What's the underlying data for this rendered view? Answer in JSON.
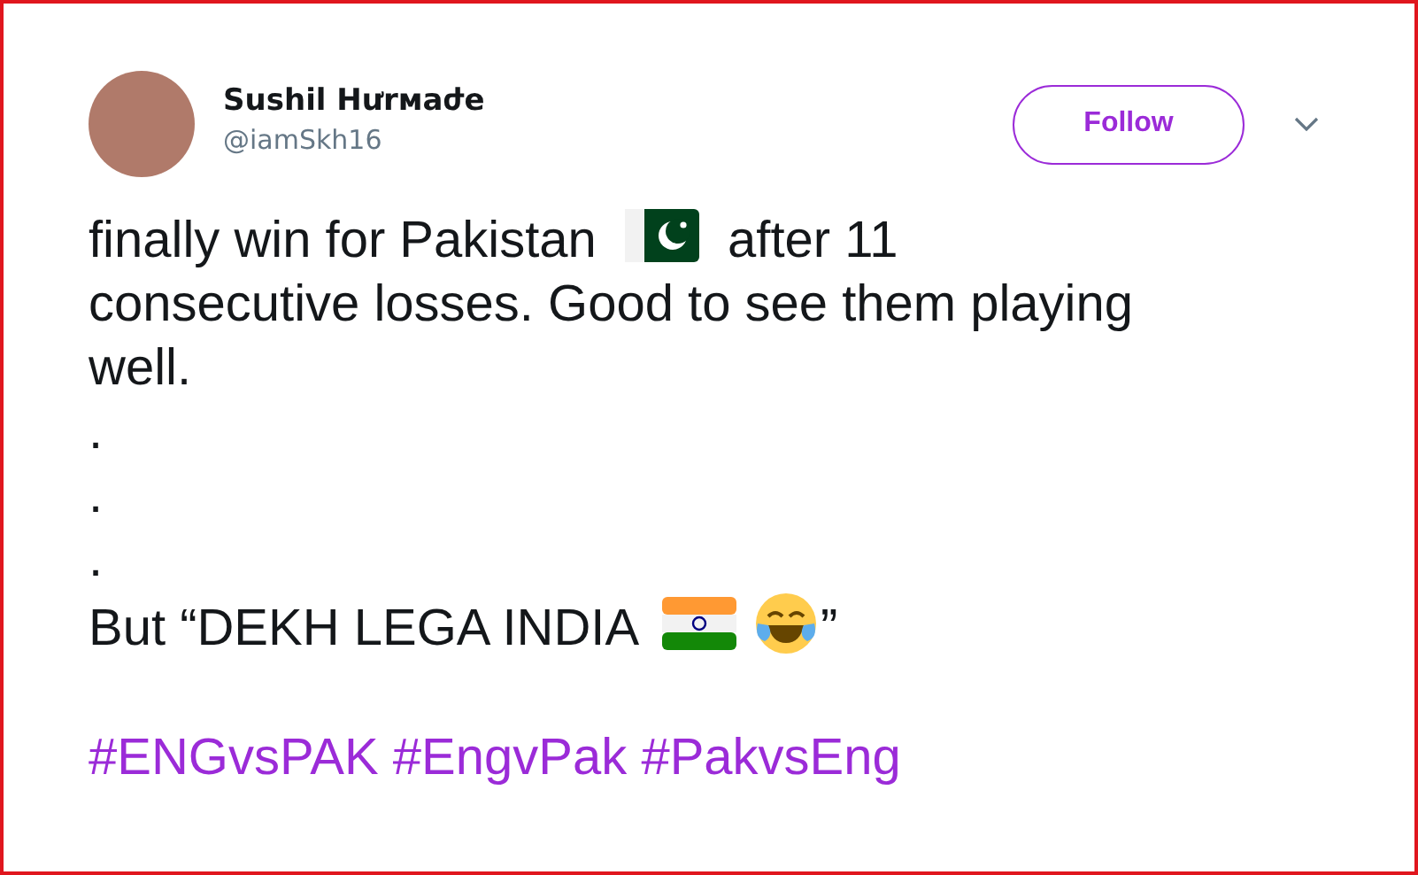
{
  "author": {
    "name": "Sushil Hưrмaժe",
    "handle": "@iamSkh16"
  },
  "follow_button": {
    "label": "Follow"
  },
  "tweet": {
    "intro_before_flag": "finally win for Pakistan",
    "intro_after_flag": "after 11",
    "continuation_lines": [
      "consecutive losses. Good to see them playing",
      "well."
    ],
    "dots": [
      ".",
      ".",
      "."
    ],
    "closing_open": "But “DEKH LEGA INDIA",
    "closing_close": "”",
    "hashtags": [
      "#ENGvsPAK",
      "#EngvPak",
      "#PakvsEng"
    ]
  }
}
